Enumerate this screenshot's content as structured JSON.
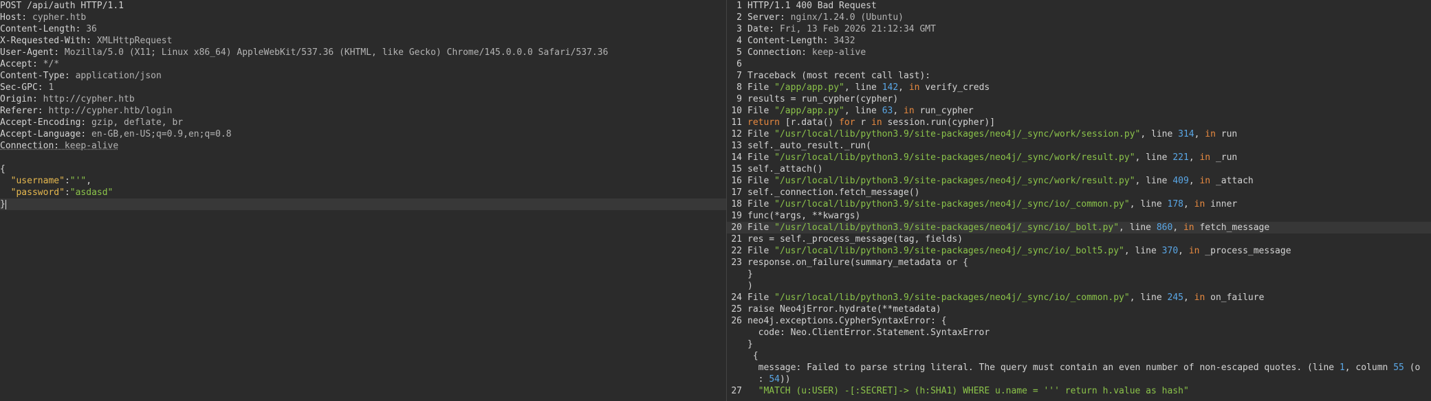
{
  "request": {
    "request_line": "POST /api/auth HTTP/1.1",
    "headers": [
      {
        "name": "Host:",
        "value": " cypher.htb"
      },
      {
        "name": "Content-Length:",
        "value": " 36"
      },
      {
        "name": "X-Requested-With:",
        "value": " XMLHttpRequest"
      },
      {
        "name": "User-Agent:",
        "value": " Mozilla/5.0 (X11; Linux x86_64) AppleWebKit/537.36 (KHTML, like Gecko) Chrome/145.0.0.0 Safari/537.36"
      },
      {
        "name": "Accept:",
        "value": " */*"
      },
      {
        "name": "Content-Type:",
        "value": " application/json"
      },
      {
        "name": "Sec-GPC:",
        "value": " 1"
      },
      {
        "name": "Origin:",
        "value": " http://cypher.htb"
      },
      {
        "name": "Referer:",
        "value": " http://cypher.htb/login"
      },
      {
        "name": "Accept-Encoding:",
        "value": " gzip, deflate, br"
      },
      {
        "name": "Accept-Language:",
        "value": " en-GB,en-US;q=0.9,en;q=0.8"
      },
      {
        "name": "Connection:",
        "value": " keep-alive"
      }
    ],
    "body_open": "{",
    "username_key": "\"username\"",
    "username_value": "\"'\"",
    "password_key": "\"password\"",
    "password_value": "\"asdasd\"",
    "body_close": "}"
  },
  "response": {
    "lines": [
      {
        "n": "1",
        "parts": [
          [
            "plain",
            "HTTP/1.1 400 Bad Request"
          ]
        ]
      },
      {
        "n": "2",
        "parts": [
          [
            "plain",
            "Server: "
          ],
          [
            "val",
            "nginx/1.24.0 (Ubuntu)"
          ]
        ]
      },
      {
        "n": "3",
        "parts": [
          [
            "plain",
            "Date: "
          ],
          [
            "val",
            "Fri, 13 Feb 2026 21:12:34 GMT"
          ]
        ]
      },
      {
        "n": "4",
        "parts": [
          [
            "plain",
            "Content-Length: "
          ],
          [
            "val",
            "3432"
          ]
        ]
      },
      {
        "n": "5",
        "parts": [
          [
            "plain",
            "Connection: "
          ],
          [
            "val",
            "keep-alive"
          ]
        ]
      },
      {
        "n": "6",
        "parts": []
      },
      {
        "n": "7",
        "parts": [
          [
            "plain",
            "Traceback (most recent call last):"
          ]
        ]
      },
      {
        "n": "8",
        "parts": [
          [
            "plain",
            "File "
          ],
          [
            "str",
            "\"/app/app.py\""
          ],
          [
            "plain",
            ", line "
          ],
          [
            "num",
            "142"
          ],
          [
            "plain",
            ", "
          ],
          [
            "kw",
            "in"
          ],
          [
            "plain",
            " verify_creds"
          ]
        ]
      },
      {
        "n": "9",
        "parts": [
          [
            "plain",
            "results = run_cypher(cypher)"
          ]
        ]
      },
      {
        "n": "10",
        "parts": [
          [
            "plain",
            "File "
          ],
          [
            "str",
            "\"/app/app.py\""
          ],
          [
            "plain",
            ", line "
          ],
          [
            "num",
            "63"
          ],
          [
            "plain",
            ", "
          ],
          [
            "kw",
            "in"
          ],
          [
            "plain",
            " run_cypher"
          ]
        ]
      },
      {
        "n": "11",
        "parts": [
          [
            "kw",
            "return"
          ],
          [
            "plain",
            " [r.data() "
          ],
          [
            "kw",
            "for"
          ],
          [
            "plain",
            " r "
          ],
          [
            "kw",
            "in"
          ],
          [
            "plain",
            " session.run(cypher)]"
          ]
        ]
      },
      {
        "n": "12",
        "parts": [
          [
            "plain",
            "File "
          ],
          [
            "str",
            "\"/usr/local/lib/python3.9/site-packages/neo4j/_sync/work/session.py\""
          ],
          [
            "plain",
            ", line "
          ],
          [
            "num",
            "314"
          ],
          [
            "plain",
            ", "
          ],
          [
            "kw",
            "in"
          ],
          [
            "plain",
            " run"
          ]
        ]
      },
      {
        "n": "13",
        "parts": [
          [
            "plain",
            "self._auto_result._run("
          ]
        ]
      },
      {
        "n": "14",
        "parts": [
          [
            "plain",
            "File "
          ],
          [
            "str",
            "\"/usr/local/lib/python3.9/site-packages/neo4j/_sync/work/result.py\""
          ],
          [
            "plain",
            ", line "
          ],
          [
            "num",
            "221"
          ],
          [
            "plain",
            ", "
          ],
          [
            "kw",
            "in"
          ],
          [
            "plain",
            " _run"
          ]
        ]
      },
      {
        "n": "15",
        "parts": [
          [
            "plain",
            "self._attach()"
          ]
        ]
      },
      {
        "n": "16",
        "parts": [
          [
            "plain",
            "File "
          ],
          [
            "str",
            "\"/usr/local/lib/python3.9/site-packages/neo4j/_sync/work/result.py\""
          ],
          [
            "plain",
            ", line "
          ],
          [
            "num",
            "409"
          ],
          [
            "plain",
            ", "
          ],
          [
            "kw",
            "in"
          ],
          [
            "plain",
            " _attach"
          ]
        ]
      },
      {
        "n": "17",
        "parts": [
          [
            "plain",
            "self._connection.fetch_message()"
          ]
        ]
      },
      {
        "n": "18",
        "parts": [
          [
            "plain",
            "File "
          ],
          [
            "str",
            "\"/usr/local/lib/python3.9/site-packages/neo4j/_sync/io/_common.py\""
          ],
          [
            "plain",
            ", line "
          ],
          [
            "num",
            "178"
          ],
          [
            "plain",
            ", "
          ],
          [
            "kw",
            "in"
          ],
          [
            "plain",
            " inner"
          ]
        ]
      },
      {
        "n": "19",
        "parts": [
          [
            "plain",
            "func(*args, **kwargs)"
          ]
        ]
      },
      {
        "n": "20",
        "active": true,
        "parts": [
          [
            "plain",
            "File "
          ],
          [
            "str",
            "\"/usr/local/lib/python3.9/site-packages/neo4j/_sync/io/_bolt.py\""
          ],
          [
            "plain",
            ", line "
          ],
          [
            "num",
            "860"
          ],
          [
            "plain",
            ", "
          ],
          [
            "kw",
            "in"
          ],
          [
            "plain",
            " fetch_message"
          ]
        ]
      },
      {
        "n": "21",
        "parts": [
          [
            "plain",
            "res = self._process_message(tag, fields)"
          ]
        ]
      },
      {
        "n": "22",
        "parts": [
          [
            "plain",
            "File "
          ],
          [
            "str",
            "\"/usr/local/lib/python3.9/site-packages/neo4j/_sync/io/_bolt5.py\""
          ],
          [
            "plain",
            ", line "
          ],
          [
            "num",
            "370"
          ],
          [
            "plain",
            ", "
          ],
          [
            "kw",
            "in"
          ],
          [
            "plain",
            " _process_message"
          ]
        ]
      },
      {
        "n": "23",
        "parts": [
          [
            "plain",
            "response.on_failure(summary_metadata or {"
          ]
        ]
      },
      {
        "n": "",
        "parts": [
          [
            "plain",
            "}"
          ]
        ]
      },
      {
        "n": "",
        "parts": [
          [
            "plain",
            ")"
          ]
        ]
      },
      {
        "n": "24",
        "parts": [
          [
            "plain",
            "File "
          ],
          [
            "str",
            "\"/usr/local/lib/python3.9/site-packages/neo4j/_sync/io/_common.py\""
          ],
          [
            "plain",
            ", line "
          ],
          [
            "num",
            "245"
          ],
          [
            "plain",
            ", "
          ],
          [
            "kw",
            "in"
          ],
          [
            "plain",
            " on_failure"
          ]
        ]
      },
      {
        "n": "25",
        "parts": [
          [
            "plain",
            "raise Neo4jError.hydrate(**metadata)"
          ]
        ]
      },
      {
        "n": "26",
        "parts": [
          [
            "plain",
            "neo4j.exceptions.CypherSyntaxError: {"
          ]
        ]
      },
      {
        "n": "",
        "parts": [
          [
            "plain",
            "  code: Neo.ClientError.Statement.SyntaxError"
          ]
        ]
      },
      {
        "n": "",
        "parts": [
          [
            "plain",
            "}"
          ]
        ]
      },
      {
        "n": "",
        "parts": [
          [
            "plain",
            " {"
          ]
        ]
      },
      {
        "n": "",
        "parts": [
          [
            "plain",
            "  message: Failed to parse string literal. The query must contain an even number of non-escaped quotes. (line "
          ],
          [
            "num",
            "1"
          ],
          [
            "plain",
            ", column "
          ],
          [
            "num",
            "55"
          ],
          [
            "plain",
            " (o"
          ]
        ]
      },
      {
        "n": "",
        "parts": [
          [
            "plain",
            "  : "
          ],
          [
            "num",
            "54"
          ],
          [
            "plain",
            "))"
          ]
        ]
      },
      {
        "n": "27",
        "parts": [
          [
            "plain",
            "  "
          ],
          [
            "str",
            "\"MATCH (u:USER) -[:SECRET]-> (h:SHA1) WHERE u.name = ''' return h.value as hash\""
          ]
        ]
      }
    ]
  },
  "colors": {
    "background": "#2b2b2b",
    "string": "#8bc34a",
    "keyword": "#e98a40",
    "number": "#5aa7e6",
    "json_key": "#e6b84f"
  }
}
